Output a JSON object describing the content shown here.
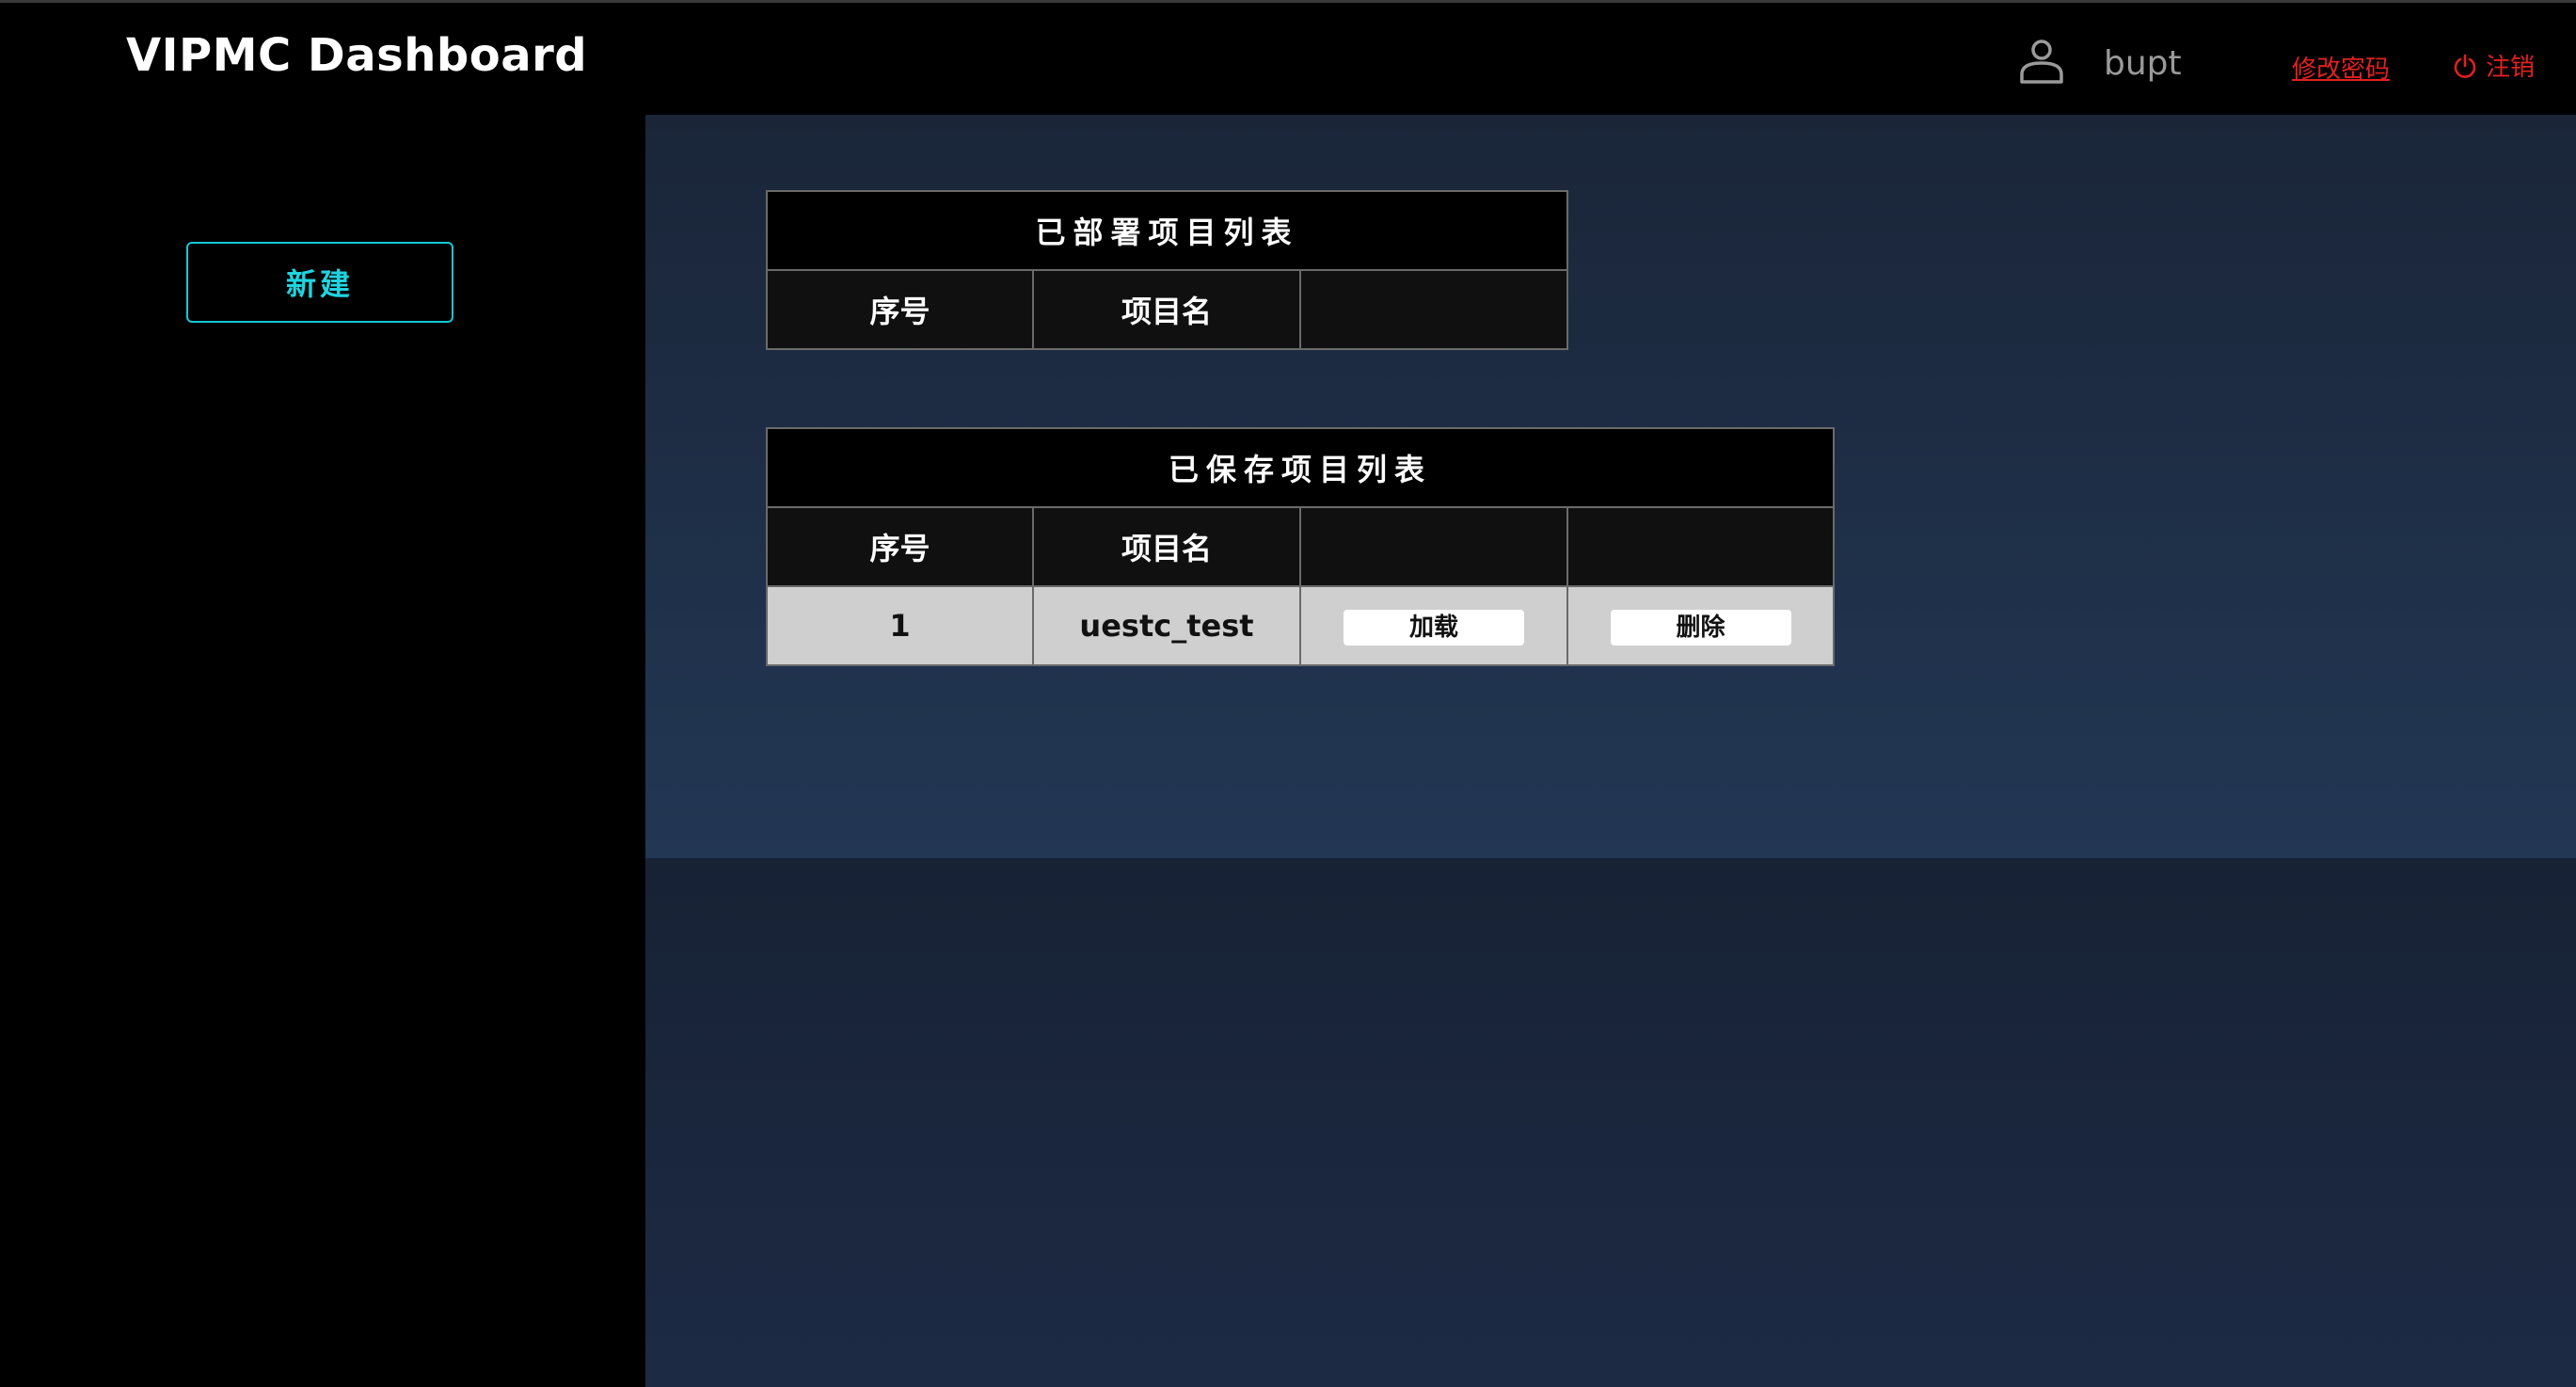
{
  "header": {
    "app_title": "VIPMC Dashboard",
    "username": "bupt",
    "change_password_label": "修改密码",
    "logout_label": "注销",
    "colors": {
      "link_red": "#e02020"
    }
  },
  "sidebar": {
    "new_button_label": "新建",
    "accent": "#1fd4e0"
  },
  "deployed_table": {
    "title": "已部署项目列表",
    "columns": [
      "序号",
      "项目名",
      ""
    ],
    "rows": []
  },
  "saved_table": {
    "title": "已保存项目列表",
    "columns": [
      "序号",
      "项目名",
      "",
      ""
    ],
    "rows": [
      {
        "index": "1",
        "name": "uestc_test",
        "load_label": "加载",
        "delete_label": "删除"
      }
    ]
  }
}
